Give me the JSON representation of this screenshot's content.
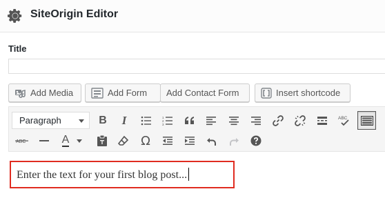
{
  "header": {
    "title": "SiteOrigin Editor",
    "icon": "gear-icon"
  },
  "title_field": {
    "label": "Title",
    "value": "",
    "placeholder": ""
  },
  "media_buttons": [
    {
      "label": "Add Media",
      "icon": "media-icon"
    },
    {
      "label": "Add Form",
      "icon": "form-icon"
    },
    {
      "label": "Add Contact Form",
      "icon": ""
    },
    {
      "label": "Insert shortcode",
      "icon": "shortcode-icon"
    }
  ],
  "toolbar": {
    "format_select": "Paragraph",
    "row1": [
      "bold",
      "italic",
      "bulleted-list",
      "numbered-list",
      "blockquote",
      "align-left",
      "align-center",
      "align-right",
      "insert-link",
      "remove-link",
      "read-more",
      "spellcheck",
      "toolbar-toggle"
    ],
    "row2": [
      "strikethrough",
      "horizontal-line",
      "text-color",
      "paste-as-text",
      "clear-formatting",
      "special-character",
      "outdent",
      "indent",
      "undo",
      "redo",
      "keyboard-shortcuts"
    ],
    "toolbar_toggle_active": true,
    "text_color_letter": "A",
    "bold_letter": "B",
    "italic_letter": "I",
    "strike_text": "ABC",
    "spell_text": "ABC",
    "omega": "Ω"
  },
  "editor": {
    "content": "Enter the text for your first blog post..."
  },
  "colors": {
    "highlight_border": "#e02b20",
    "toolbar_bg": "#f5f5f5",
    "header_bg": "#fcfcfc"
  }
}
